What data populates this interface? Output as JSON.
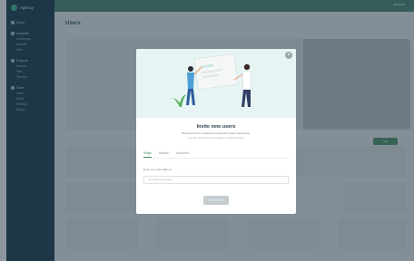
{
  "sidebar": {
    "brand": "Agency",
    "sections": [
      {
        "label": "Home",
        "items": []
      },
      {
        "label": "Analytics",
        "items": [
          "Dashboard",
          "Reports",
          "Data"
        ]
      },
      {
        "label": "Projects",
        "items": [
          "Kanban",
          "Files",
          "Timeline"
        ]
      },
      {
        "label": "Team",
        "items": [
          "Users",
          "Roles",
          "Settings",
          "Billing"
        ]
      }
    ]
  },
  "topbar": {
    "user": "Account"
  },
  "page": {
    "title": "Users",
    "add_button": "Add"
  },
  "modal": {
    "title": "Invite new users",
    "subtitle": "We'll send them a welcome email with setup instructions.",
    "subtitle2": "You can customize the invitation in Team Settings.",
    "tabs": [
      "Single",
      "Multiple",
      "Advanced"
    ],
    "field_label": "Enter an email address",
    "field_placeholder": "name@company.com",
    "send_button": "Send invite",
    "close_glyph": "×"
  },
  "colors": {
    "sidebar": "#1f3f52",
    "topbar": "#4a7f72",
    "accent": "#3f8f66"
  }
}
